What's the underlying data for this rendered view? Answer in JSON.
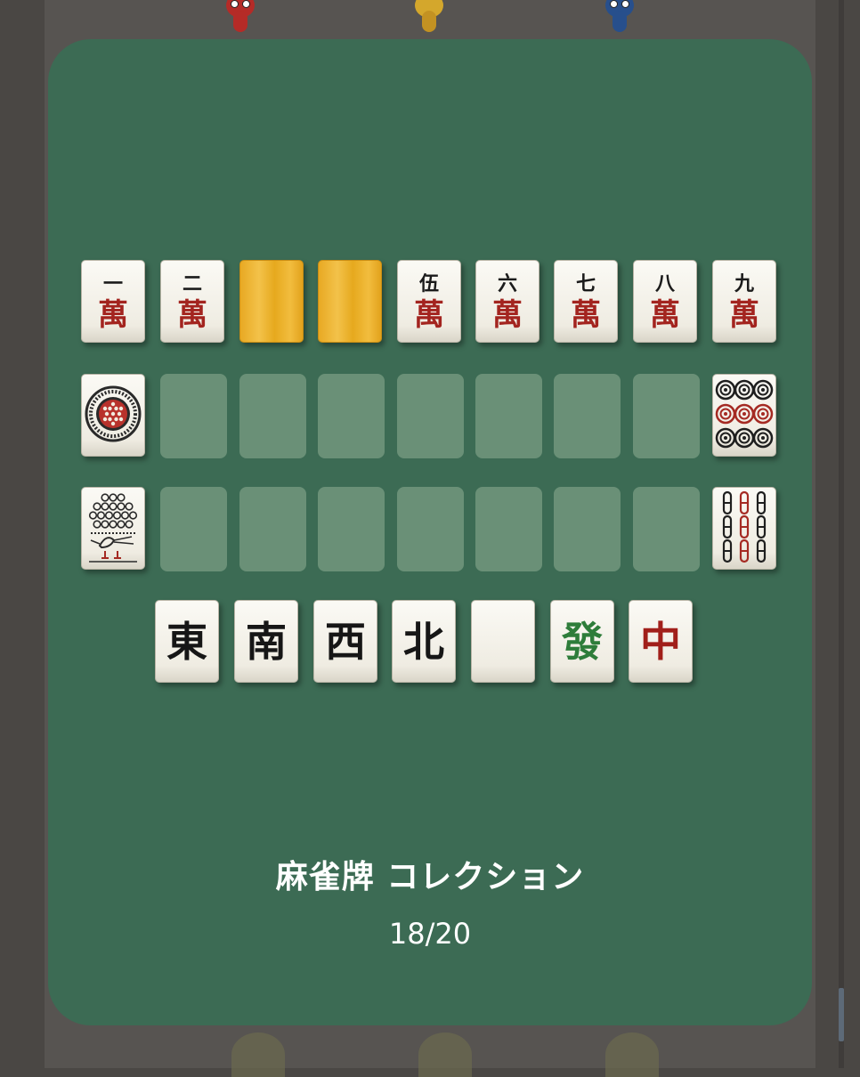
{
  "title": "麻雀牌 コレクション",
  "progress_text": "18/20",
  "progress": {
    "collected": 18,
    "total": 20
  },
  "colors": {
    "panel": "#3c6b54",
    "empty_slot": "#6a9077",
    "hidden_tile": "#f0b83a",
    "man_red": "#a3241f",
    "hatsu_green": "#2e7d3a"
  },
  "rows": [
    {
      "name": "manzu",
      "tiles": [
        {
          "state": "revealed",
          "kind": "man",
          "number_label": "一",
          "suit_label": "萬"
        },
        {
          "state": "revealed",
          "kind": "man",
          "number_label": "二",
          "suit_label": "萬"
        },
        {
          "state": "hidden"
        },
        {
          "state": "hidden"
        },
        {
          "state": "revealed",
          "kind": "man",
          "number_label": "伍",
          "suit_label": "萬"
        },
        {
          "state": "revealed",
          "kind": "man",
          "number_label": "六",
          "suit_label": "萬"
        },
        {
          "state": "revealed",
          "kind": "man",
          "number_label": "七",
          "suit_label": "萬"
        },
        {
          "state": "revealed",
          "kind": "man",
          "number_label": "八",
          "suit_label": "萬"
        },
        {
          "state": "revealed",
          "kind": "man",
          "number_label": "九",
          "suit_label": "萬"
        }
      ]
    },
    {
      "name": "pinzu",
      "tiles": [
        {
          "state": "revealed",
          "kind": "pin1",
          "icon": "one-circle-icon"
        },
        {
          "state": "empty"
        },
        {
          "state": "empty"
        },
        {
          "state": "empty"
        },
        {
          "state": "empty"
        },
        {
          "state": "empty"
        },
        {
          "state": "empty"
        },
        {
          "state": "empty"
        },
        {
          "state": "revealed",
          "kind": "pin9",
          "icon": "nine-circles-icon"
        }
      ]
    },
    {
      "name": "souzu",
      "tiles": [
        {
          "state": "revealed",
          "kind": "sou1",
          "icon": "peacock-icon"
        },
        {
          "state": "empty"
        },
        {
          "state": "empty"
        },
        {
          "state": "empty"
        },
        {
          "state": "empty"
        },
        {
          "state": "empty"
        },
        {
          "state": "empty"
        },
        {
          "state": "empty"
        },
        {
          "state": "revealed",
          "kind": "sou9",
          "icon": "nine-bamboo-icon"
        }
      ]
    },
    {
      "name": "honors",
      "tiles": [
        {
          "state": "revealed",
          "kind": "honor",
          "label": "東",
          "color": "black"
        },
        {
          "state": "revealed",
          "kind": "honor",
          "label": "南",
          "color": "black"
        },
        {
          "state": "revealed",
          "kind": "honor",
          "label": "西",
          "color": "black"
        },
        {
          "state": "revealed",
          "kind": "honor",
          "label": "北",
          "color": "black"
        },
        {
          "state": "revealed",
          "kind": "honor",
          "label": "",
          "color": "blank"
        },
        {
          "state": "revealed",
          "kind": "honor",
          "label": "發",
          "color": "green"
        },
        {
          "state": "revealed",
          "kind": "honor",
          "label": "中",
          "color": "red"
        }
      ]
    }
  ]
}
